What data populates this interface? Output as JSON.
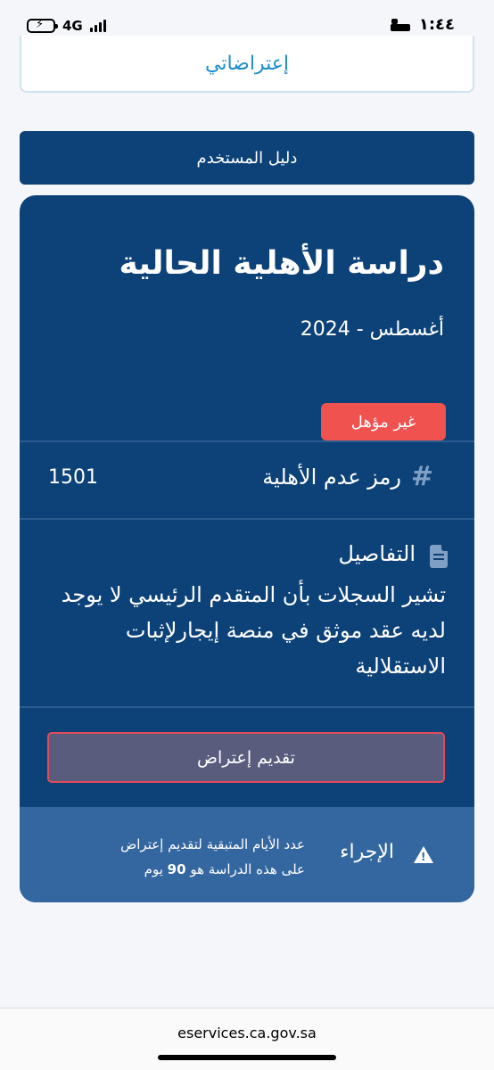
{
  "status_bar": {
    "network": "4G",
    "time": "١:٤٤"
  },
  "objections": {
    "label": "إعتراضاتي"
  },
  "user_guide": {
    "label": "دليل المستخدم"
  },
  "eligibility": {
    "title": "دراسة الأهلية الحالية",
    "date": "أغسطس - 2024",
    "status": "غير مؤهل",
    "code_label": "رمز عدم الأهلية",
    "code_value": "1501",
    "details_label": "التفاصيل",
    "details_text": "تشير السجلات بأن المتقدم الرئيسي لا يوجد لديه عقد موثق في منصة إيجارلإثبات الاستقلالية",
    "submit_objection": "تقديم إعتراض",
    "action_label": "الإجراء",
    "action_text_1": "عدد الأيام المتبقية لتقديم إعتراض",
    "action_text_2": "على هذه الدراسة هو",
    "days_remaining": "90",
    "days_unit": "يوم"
  },
  "url": "eservices.ca.gov.sa",
  "colors": {
    "primary": "#0d4279",
    "accent": "#1d8ec9",
    "danger": "#f0524f",
    "action_bg": "#3467a0"
  }
}
